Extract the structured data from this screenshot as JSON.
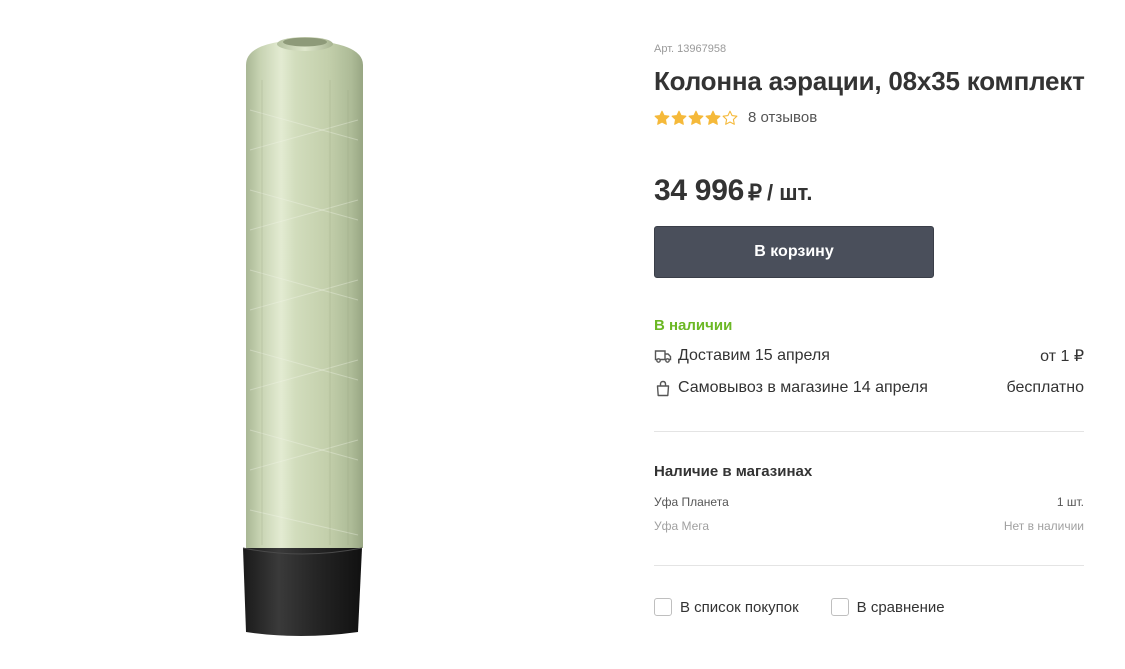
{
  "product": {
    "sku": "Арт. 13967958",
    "title": "Колонна аэрации, 08х35 комплект",
    "image_alt": "product-photo-fiberglass-tank",
    "rating": {
      "value": 4,
      "max": 5,
      "reviews_label": "8 отзывов"
    },
    "price": {
      "value": "34 996",
      "currency": "₽",
      "unit": "/ шт."
    },
    "cart_button": "В корзину",
    "availability": "В наличии",
    "delivery": {
      "icon": "truck-icon",
      "label": "Доставим 15 апреля",
      "value": "от 1 ₽"
    },
    "pickup": {
      "icon": "shopping-bag-icon",
      "label": "Самовывоз в магазине 14 апреля",
      "value": "бесплатно"
    }
  },
  "stores": {
    "title": "Наличие в магазинах",
    "items": [
      {
        "name": "Уфа Планета",
        "stock": "1 шт."
      },
      {
        "name": "Уфа Мега",
        "stock": "Нет в наличии"
      }
    ]
  },
  "actions": {
    "shopping_list": "В список покупок",
    "compare": "В сравнение"
  },
  "colors": {
    "button_bg": "#4a4f5b",
    "in_stock": "#6cb825",
    "star": "#f5b93a"
  }
}
